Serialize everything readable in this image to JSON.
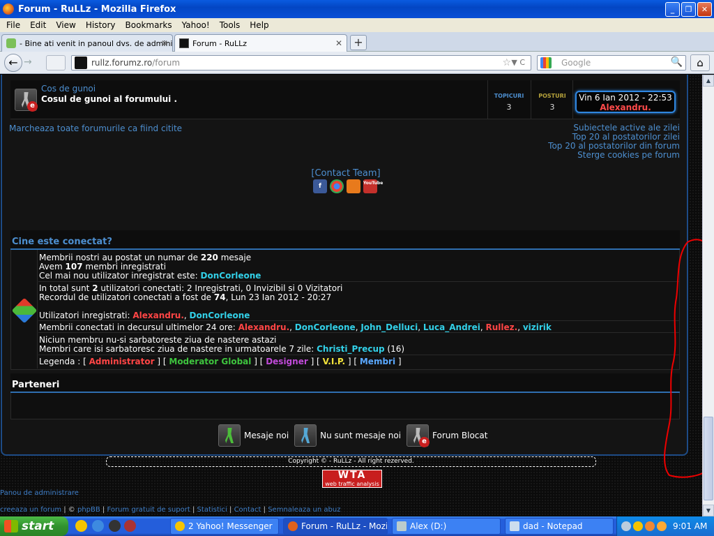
{
  "window": {
    "title": "Forum - RuLLz - Mozilla Firefox"
  },
  "menu": [
    "File",
    "Edit",
    "View",
    "History",
    "Bookmarks",
    "Yahoo!",
    "Tools",
    "Help"
  ],
  "tabs": [
    {
      "label": "- Bine ati venit in panoul dvs. de administ...",
      "active": false
    },
    {
      "label": "Forum - RuLLz",
      "active": true
    }
  ],
  "nav": {
    "url_host": "rullz.forumz.ro",
    "url_path": "/forum",
    "search_placeholder": "Google"
  },
  "forum_row": {
    "title": "Cos de gunoi",
    "description": "Cosul de gunoi al forumului .",
    "topics_label": "TOPICURI",
    "topics": "3",
    "posts_label": "POSTURI",
    "posts": "3",
    "last_post_date": "Vin 6 Ian 2012 - 22:53",
    "last_post_user": "Alexandru."
  },
  "links": {
    "mark_read": "Marcheaza toate forumurile ca fiind citite",
    "right": [
      "Subiectele active ale zilei",
      "Top 20 al postatorilor zilei",
      "Top 20 al postatorilor din forum",
      "Sterge cookies pe forum"
    ],
    "contact": "[Contact Team]"
  },
  "socials": [
    "f",
    "g",
    "rss",
    "YouTube"
  ],
  "who_online": {
    "title": "Cine este conectat?",
    "l1a": "Membrii nostri au postat un numar de ",
    "l1b": "220",
    "l1c": " mesaje",
    "l2a": "Avem ",
    "l2b": "107",
    "l2c": " membri inregistrati",
    "l3a": "Cel mai nou utilizator inregistrat este: ",
    "l3b": "DonCorleone",
    "l4a": "In total sunt ",
    "l4b": "2",
    "l4c": " utilizatori conectati: 2 Inregistrati, 0 Invizibil si 0 Vizitatori",
    "l5a": "Recordul de utilizatori conectati a fost de ",
    "l5b": "74",
    "l5c": ", Lun 23 Ian 2012 - 20:27",
    "l6a": "Utilizatori inregistrati: ",
    "l6b": "Alexandru.",
    "l6c": ", ",
    "l6d": "DonCorleone",
    "l7a": "Membrii conectati in decursul ultimelor 24 ore: ",
    "l7_users": [
      "Alexandru.",
      "DonCorleone",
      "John_Delluci",
      "Luca_Andrei",
      "Rullez.",
      "vizirik"
    ],
    "l8": "Niciun membru nu-si sarbatoreste ziua de nastere astazi",
    "l9a": "Membri care isi sarbatoresc ziua de nastere in urmatoarele 7 zile: ",
    "l9b": "Christi_Precup",
    "l9c": " (16)",
    "legend_label": "Legenda : ",
    "legend": [
      "Administrator",
      "Moderator Global",
      "Designer",
      "V.I.P.",
      "Membri"
    ]
  },
  "partners": {
    "title": "Parteneri"
  },
  "icon_legend": [
    "Mesaje noi",
    "Nu sunt mesaje noi",
    "Forum Blocat"
  ],
  "copyright": "Copyright © - RuLLz - All right rezerved.",
  "wta": {
    "big": "WTA",
    "small": "web traffic analysis"
  },
  "admin_link": "Panou de administrare",
  "footer": [
    "creeaza un forum",
    "phpBB",
    "Forum gratuit de suport",
    "Statistici",
    "Contact",
    "Semnaleaza un abuz"
  ],
  "taskbar": {
    "start": "start",
    "tasks": [
      "2 Yahoo! Messenger",
      "Forum - RuLLz - Mozill...",
      "Alex (D:)",
      "dad - Notepad"
    ],
    "clock": "9:01 AM"
  }
}
